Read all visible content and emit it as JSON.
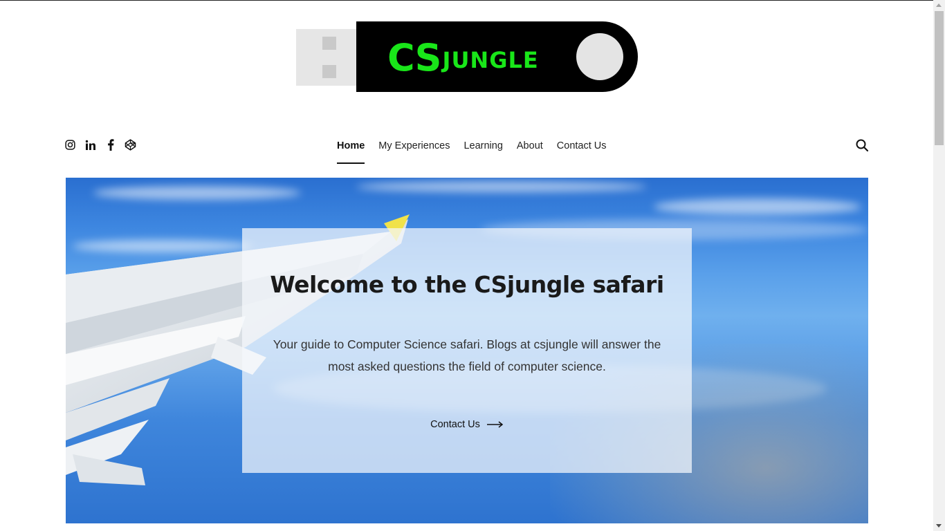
{
  "site": {
    "logo_text_big": "CS",
    "logo_text_small": "JUNGLE",
    "logo_color": "#19e619"
  },
  "social": {
    "icons": [
      "instagram-icon",
      "linkedin-icon",
      "facebook-icon",
      "codepen-icon"
    ]
  },
  "nav": {
    "items": [
      {
        "label": "Home",
        "active": true
      },
      {
        "label": "My Experiences",
        "active": false
      },
      {
        "label": "Learning",
        "active": false
      },
      {
        "label": "About",
        "active": false
      },
      {
        "label": "Contact Us",
        "active": false
      }
    ],
    "search_icon": "search-icon"
  },
  "hero": {
    "title": "Welcome to the CSjungle safari",
    "description": "Your guide to Computer Science safari. Blogs at csjungle will answer the most asked questions the field of computer science.",
    "cta_label": "Contact Us",
    "cta_icon": "arrow-right-icon"
  }
}
